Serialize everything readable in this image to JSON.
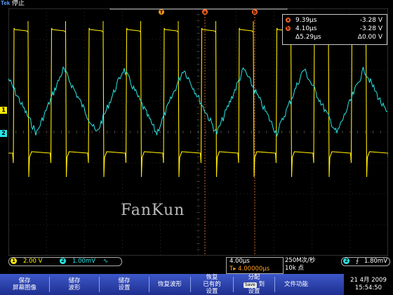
{
  "header": {
    "brand": "Tek",
    "status": "停止"
  },
  "trigger_markers": [
    "T",
    "a",
    "b"
  ],
  "cursors": {
    "rows": [
      {
        "icon": "a",
        "time": "9.39µs",
        "value": "-3.28 V"
      },
      {
        "icon": "b",
        "time": "4.10µs",
        "value": "-3.28 V"
      },
      {
        "icon": "",
        "time": "Δ5.29µs",
        "value": "Δ0.00 V"
      }
    ]
  },
  "channel_markers": {
    "ch1": "1",
    "ch2": "2"
  },
  "watermark": "FanKun",
  "info": {
    "ch1_num": "1",
    "ch1_scale": "2.00 V",
    "ch2_num": "2",
    "ch2_scale": "1.00mV",
    "ch2_bw": "∿",
    "timebase": "4.00µs",
    "trigger_pos": "T▸ 4.00000µs",
    "sample_rate": "250M次/秒",
    "record_length": "10k 点",
    "trig_num": "2",
    "trig_slope": "⨍",
    "trig_level": "1.80mV"
  },
  "menu": {
    "items": [
      {
        "line1": "保存",
        "line2": "屏幕图像"
      },
      {
        "line1": "储存",
        "line2": "波形"
      },
      {
        "line1": "储存",
        "line2": "设置"
      },
      {
        "line1": "恢复波形",
        "line2": ""
      },
      {
        "line1": "恢复",
        "line2": "已有的",
        "line3": "设置"
      },
      {
        "line1": "分配",
        "line2": "到",
        "line3": "设置",
        "badge": "Save"
      },
      {
        "line1": "文件功能",
        "line2": ""
      }
    ]
  },
  "datetime": {
    "date": "21 4月 2009",
    "time": "15:54:50"
  },
  "colors": {
    "ch1": "#ffea00",
    "ch2": "#28e5e5",
    "menu": "#2a44b0",
    "cursor": "#ff6a2a"
  }
}
